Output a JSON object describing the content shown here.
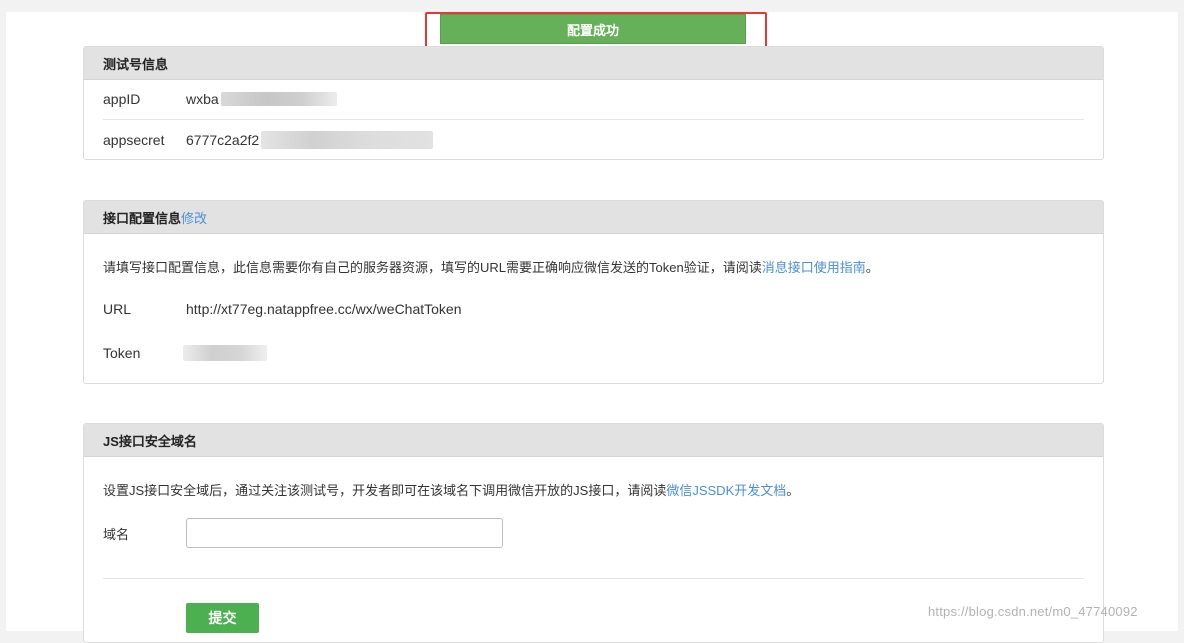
{
  "toast": {
    "text": "配置成功"
  },
  "test_account": {
    "title": "测试号信息",
    "appid_label": "appID",
    "appid_value": "wxba",
    "appsecret_label": "appsecret",
    "appsecret_value": "6777c2a2f2"
  },
  "interface_config": {
    "title": "接口配置信息",
    "edit_link": "修改",
    "description": "请填写接口配置信息，此信息需要你有自己的服务器资源，填写的URL需要正确响应微信发送的Token验证，请阅读",
    "guide_link": "消息接口使用指南",
    "description_end": "。",
    "url_label": "URL",
    "url_value": "http://xt77eg.natappfree.cc/wx/weChatToken",
    "token_label": "Token"
  },
  "js_domain": {
    "title": "JS接口安全域名",
    "description": "设置JS接口安全域后，通过关注该测试号，开发者即可在该域名下调用微信开放的JS接口，请阅读",
    "doc_link": "微信JSSDK开发文档",
    "description_end": "。",
    "domain_label": "域名",
    "domain_value": "",
    "submit_label": "提交"
  },
  "watermark": "https://blog.csdn.net/m0_47740092"
}
